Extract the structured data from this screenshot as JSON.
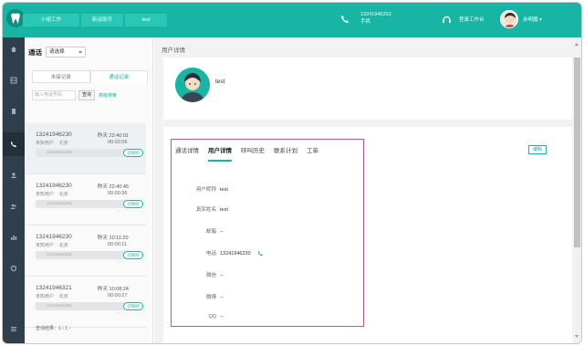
{
  "top": {
    "tabs": [
      "小组工作",
      "新话助可",
      "test"
    ],
    "agent_number": "13241946203",
    "agent_sub": "手机",
    "status": "登录工作台",
    "user": "余明魔 ▾"
  },
  "rail": {
    "icons": [
      "home-icon",
      "grid-icon",
      "doc-icon",
      "phone-icon",
      "user-icon",
      "users-icon",
      "chart-icon",
      "gear-icon",
      "menu-icon"
    ],
    "active": "phone-icon"
  },
  "list": {
    "title": "通话",
    "select_value": "请选择",
    "tabs": [
      "未接记录",
      "通话记录"
    ],
    "search_placeholder": "输入电话号码",
    "search_btn": "查询",
    "adv_link": "高级搜索",
    "calls": [
      {
        "number": "13241946230",
        "time": "昨天 22:40:01",
        "who": "未知用户",
        "city": "北京",
        "duration": "00:02:06",
        "rec": "13241946205",
        "rec_btn": "已接听"
      },
      {
        "number": "13241946230",
        "time": "昨天 22:40:45",
        "who": "未知用户",
        "city": "北京",
        "duration": "00:00:36",
        "rec": "13241946205",
        "rec_btn": "已接听"
      },
      {
        "number": "13241946230",
        "time": "昨天 10:11:20",
        "who": "未知用户",
        "city": "北京",
        "duration": "00:00:11",
        "rec": "13241946205",
        "rec_btn": "已接听"
      },
      {
        "number": "13241946321",
        "time": "昨天 10:08:24",
        "who": "未知用户",
        "city": "北京",
        "duration": "00:00:27",
        "rec": "13241946205",
        "rec_btn": "已接听"
      }
    ],
    "pager": "查询结果：1    ‹  1  ›"
  },
  "main": {
    "title": "用户详情",
    "username": "test",
    "tabs": [
      "通话详情",
      "用户详情",
      "呼叫历史",
      "联系计划",
      "工单"
    ],
    "active_tab": "用户详情",
    "edit_btn": "编辑",
    "fields": [
      {
        "k": "用户昵称",
        "v": "test"
      },
      {
        "k": "真实姓名",
        "v": "test"
      },
      {
        "k": "邮箱",
        "v": "--"
      },
      {
        "k": "电话",
        "v": "13241946230"
      },
      {
        "k": "微信",
        "v": "--"
      },
      {
        "k": "微博",
        "v": "--"
      },
      {
        "k": "QQ",
        "v": "--"
      }
    ]
  },
  "colors": {
    "accent": "#19b5a4",
    "rail": "#2f3f4c",
    "highlight": "#e0507a"
  }
}
